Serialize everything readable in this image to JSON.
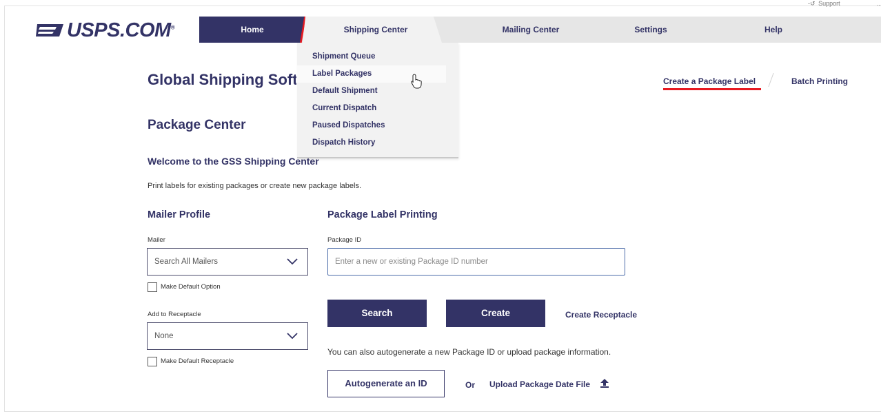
{
  "top_util": {
    "label": "Support",
    "icon": "support-icon",
    "more": "..."
  },
  "brand": {
    "name": "USPS.COM",
    "reg": "®"
  },
  "nav": {
    "home": "Home",
    "shipping_center": "Shipping Center",
    "mailing_center": "Mailing Center",
    "settings": "Settings",
    "help": "Help"
  },
  "dropdown": {
    "items": [
      "Shipment Queue",
      "Label Packages",
      "Default Shipment",
      "Current Dispatch",
      "Paused Dispatches",
      "Dispatch History"
    ],
    "hovered": "Label Packages"
  },
  "page": {
    "title": "Global Shipping Software",
    "subtitle": "Package Center",
    "welcome": "Welcome to the GSS Shipping Center",
    "intro": "Print labels for existing packages or create new package labels."
  },
  "links": {
    "create_label": "Create a Package Label",
    "batch_printing": "Batch Printing"
  },
  "mailer_profile": {
    "heading": "Mailer Profile",
    "mailer_label": "Mailer",
    "mailer_value": "Search All Mailers",
    "make_default_option": "Make Default Option",
    "receptacle_label": "Add to Receptacle",
    "receptacle_value": "None",
    "make_default_receptacle": "Make Default Receptacle"
  },
  "label_printing": {
    "heading": "Package Label Printing",
    "package_id_label": "Package ID",
    "package_id_placeholder": "Enter a new or existing Package ID number",
    "search": "Search",
    "create": "Create",
    "create_receptacle": "Create Receptacle",
    "autogen_text": "You can also autogenerate a new Package ID or upload package information.",
    "autogenerate": "Autogenerate an ID",
    "or": "Or",
    "upload": "Upload Package Date File"
  },
  "colors": {
    "brand_navy": "#333366",
    "accent_red": "#e71921",
    "nav_gray": "#e6e6e6"
  }
}
